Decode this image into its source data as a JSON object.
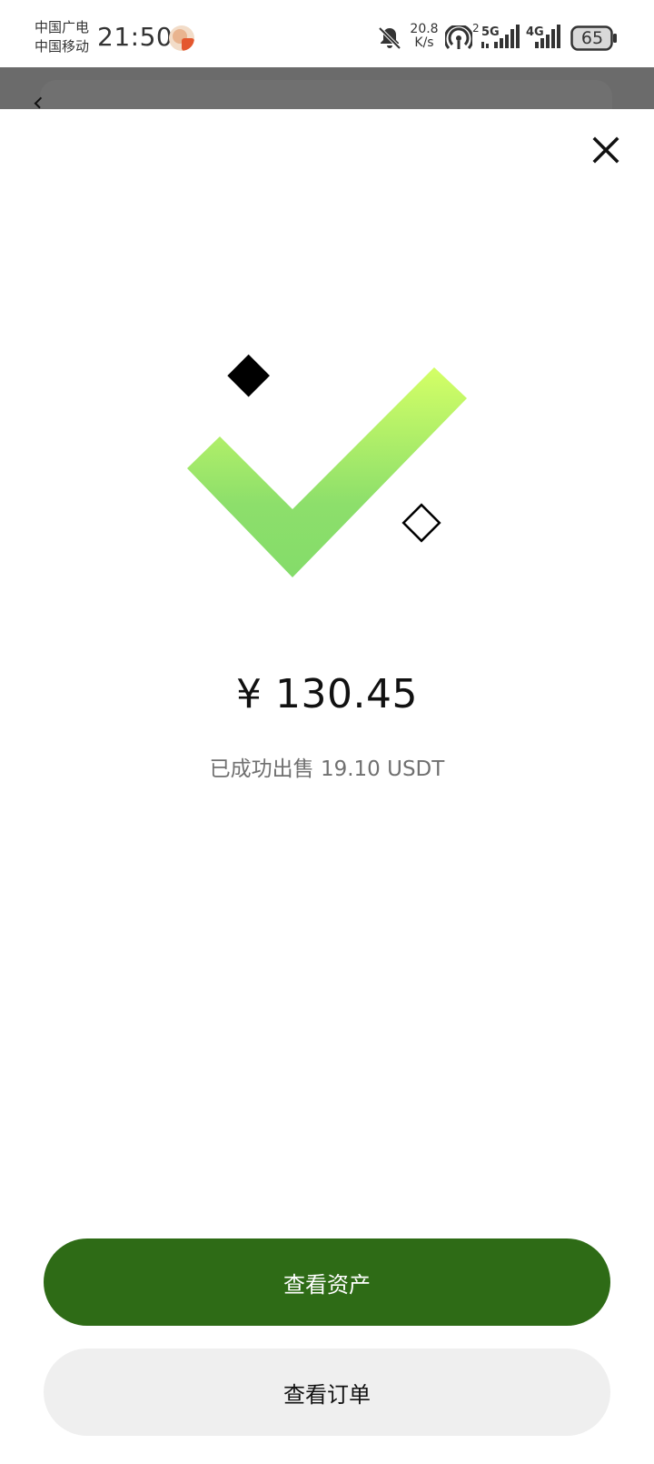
{
  "status_bar": {
    "carrier_1": "中国广电",
    "carrier_2": "中国移动",
    "time": "21:50",
    "net_speed_value": "20.8",
    "net_speed_unit": "K/s",
    "hotspot_count": "2",
    "network_5g": "5G",
    "network_4g": "4G",
    "battery": "65"
  },
  "result": {
    "amount": "¥ 130.45",
    "message": "已成功出售 19.10 USDT"
  },
  "actions": {
    "view_assets": "查看资产",
    "view_orders": "查看订单"
  },
  "colors": {
    "primary_button": "#2e6b16",
    "secondary_button": "#efefef",
    "check_top": "#d4ff66",
    "check_bottom": "#84dc6a"
  },
  "icons": {
    "close": "close-icon",
    "success": "checkmark-icon"
  }
}
